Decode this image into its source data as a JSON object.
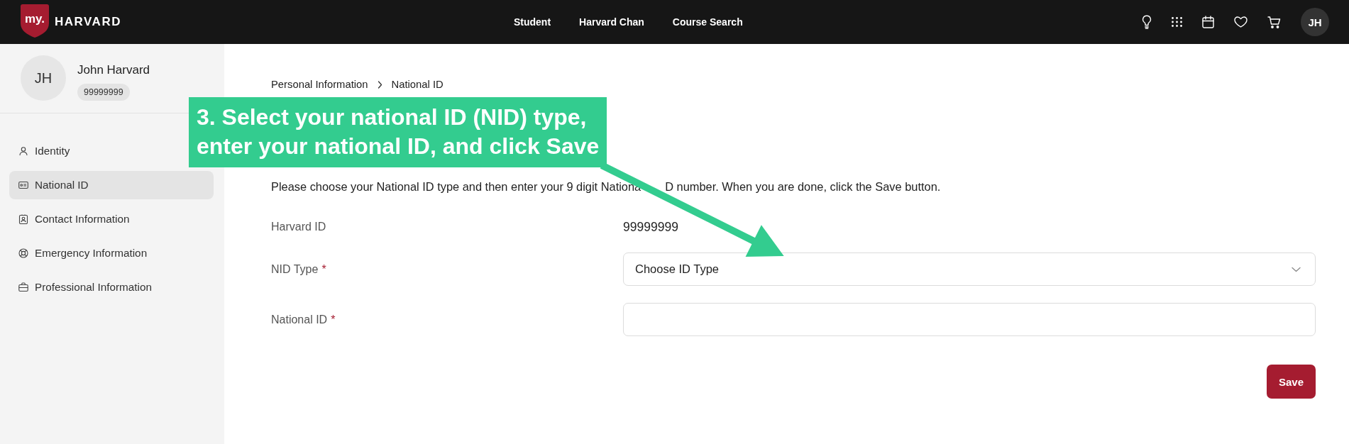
{
  "top_bar": {
    "logo": {
      "badge": "my.",
      "wordmark": "HARVARD"
    },
    "nav_links": [
      "Student",
      "Harvard Chan",
      "Course Search"
    ],
    "avatar_initials": "JH"
  },
  "sidebar": {
    "profile": {
      "initials": "JH",
      "name": "John Harvard",
      "id_badge": "99999999"
    },
    "items": [
      {
        "label": "Identity",
        "selected": false
      },
      {
        "label": "National ID",
        "selected": true
      },
      {
        "label": "Contact Information",
        "selected": false
      },
      {
        "label": "Emergency Information",
        "selected": false
      },
      {
        "label": "Professional Information",
        "selected": false
      }
    ]
  },
  "main": {
    "breadcrumb": [
      "Personal Information",
      "National ID"
    ],
    "instruction_parts": [
      "Please choose your National ID type and then enter your 9 digit Nationa",
      "D number. When you are done, click the Save button."
    ],
    "form": {
      "rows": [
        {
          "kind": "readonly",
          "label": "Harvard ID",
          "value": "99999999"
        },
        {
          "kind": "select",
          "label": "NID Type",
          "required_mark": "*",
          "value": "Choose ID Type"
        },
        {
          "kind": "input",
          "label": "National ID",
          "required_mark": "*"
        }
      ]
    },
    "primary_button": "Save"
  },
  "annotation": {
    "callout": "3. Select your national ID (NID) type, enter your national ID, and click Save"
  }
}
